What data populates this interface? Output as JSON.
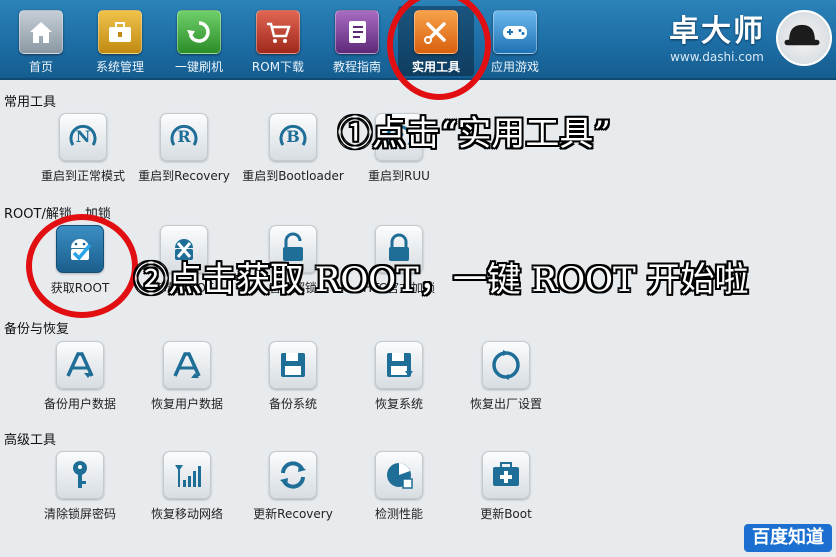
{
  "nav": {
    "items": [
      {
        "label": "首页",
        "icon": "home-icon",
        "color": "#9aa6b0"
      },
      {
        "label": "系统管理",
        "icon": "toolbox-icon",
        "color": "#d8a422"
      },
      {
        "label": "一键刷机",
        "icon": "refresh-icon",
        "color": "#3fae3a"
      },
      {
        "label": "ROM下载",
        "icon": "cart-icon",
        "color": "#c33b2b"
      },
      {
        "label": "教程指南",
        "icon": "notebook-icon",
        "color": "#7b3f95"
      },
      {
        "label": "实用工具",
        "icon": "tools-icon",
        "color": "#e87a1d",
        "active": true
      },
      {
        "label": "应用游戏",
        "icon": "gamepad-icon",
        "color": "#2f8ed4"
      }
    ]
  },
  "brand": {
    "name": "卓大师",
    "url": "www.dashi.com"
  },
  "sections": [
    {
      "title": "常用工具",
      "tools": [
        {
          "label": "重启到正常模式",
          "icon": "reboot-normal-icon"
        },
        {
          "label": "重启到Recovery",
          "icon": "reboot-recovery-icon"
        },
        {
          "label": "重启到Bootloader",
          "icon": "reboot-bootloader-icon"
        },
        {
          "label": "重启到RUU",
          "icon": "reboot-ruu-icon"
        }
      ]
    },
    {
      "title": "ROOT/解锁、加锁",
      "tools": [
        {
          "label": "获取ROOT",
          "icon": "android-root-icon"
        },
        {
          "label": "卸载ROOT",
          "icon": "android-unroot-icon"
        },
        {
          "label": "官方解锁",
          "icon": "unlock-icon"
        },
        {
          "label": "HTC官方加锁",
          "icon": "lock-icon"
        }
      ]
    },
    {
      "title": "备份与恢复",
      "tools": [
        {
          "label": "备份用户数据",
          "icon": "backup-user-icon"
        },
        {
          "label": "恢复用户数据",
          "icon": "restore-user-icon"
        },
        {
          "label": "备份系统",
          "icon": "save-system-icon"
        },
        {
          "label": "恢复系统",
          "icon": "restore-system-icon"
        },
        {
          "label": "恢复出厂设置",
          "icon": "factory-reset-icon"
        }
      ]
    },
    {
      "title": "高级工具",
      "tools": [
        {
          "label": "清除锁屏密码",
          "icon": "key-icon"
        },
        {
          "label": "恢复移动网络",
          "icon": "signal-icon"
        },
        {
          "label": "更新Recovery",
          "icon": "update-recovery-icon"
        },
        {
          "label": "检测性能",
          "icon": "performance-icon"
        },
        {
          "label": "更新Boot",
          "icon": "update-boot-icon"
        }
      ]
    }
  ],
  "annotations": {
    "step1": "①点击“实用工具”",
    "step2": "②点击获取 ROOT，一键 ROOT 开始啦"
  },
  "watermark": "百度知道",
  "colors": {
    "highlight": "#e10f12",
    "icon_blue": "#1e6e97"
  }
}
